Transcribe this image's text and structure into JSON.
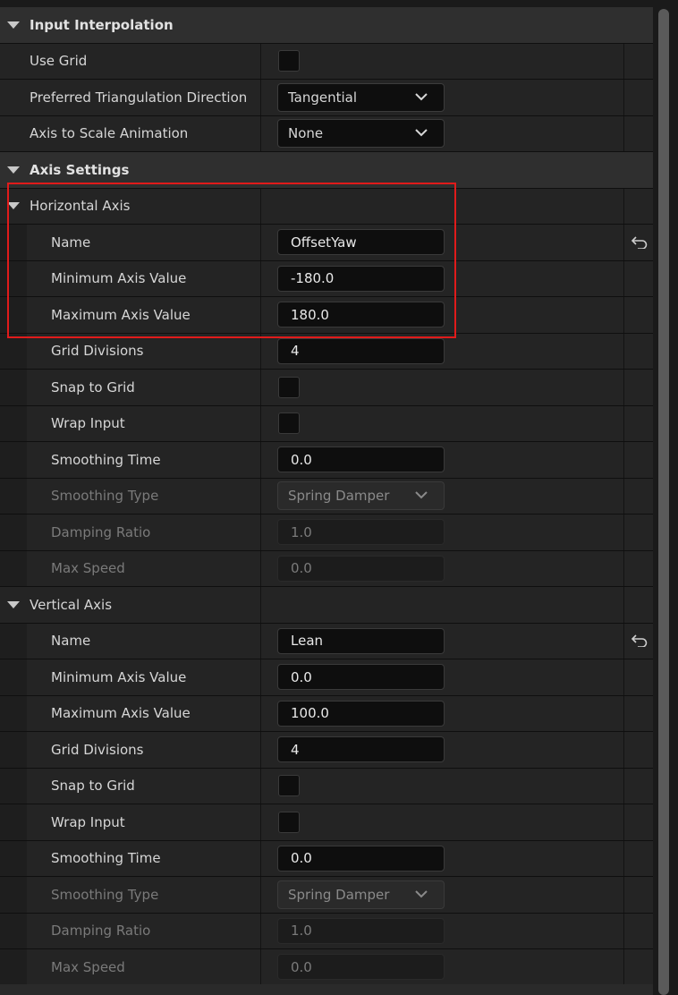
{
  "input_interpolation": {
    "header": "Input Interpolation",
    "use_grid_label": "Use Grid",
    "triangulation_label": "Preferred Triangulation Direction",
    "triangulation_value": "Tangential",
    "axis_scale_label": "Axis to Scale Animation",
    "axis_scale_value": "None"
  },
  "axis_settings": {
    "header": "Axis Settings"
  },
  "horizontal_axis": {
    "header": "Horizontal Axis",
    "name_label": "Name",
    "name_value": "OffsetYaw",
    "min_label": "Minimum Axis Value",
    "min_value": "-180.0",
    "max_label": "Maximum Axis Value",
    "max_value": "180.0",
    "grid_div_label": "Grid Divisions",
    "grid_div_value": "4",
    "snap_label": "Snap to Grid",
    "wrap_label": "Wrap Input",
    "smoothing_time_label": "Smoothing Time",
    "smoothing_time_value": "0.0",
    "smoothing_type_label": "Smoothing Type",
    "smoothing_type_value": "Spring Damper",
    "damping_label": "Damping Ratio",
    "damping_value": "1.0",
    "max_speed_label": "Max Speed",
    "max_speed_value": "0.0"
  },
  "vertical_axis": {
    "header": "Vertical Axis",
    "name_label": "Name",
    "name_value": "Lean",
    "min_label": "Minimum Axis Value",
    "min_value": "0.0",
    "max_label": "Maximum Axis Value",
    "max_value": "100.0",
    "grid_div_label": "Grid Divisions",
    "grid_div_value": "4",
    "snap_label": "Snap to Grid",
    "wrap_label": "Wrap Input",
    "smoothing_time_label": "Smoothing Time",
    "smoothing_time_value": "0.0",
    "smoothing_type_label": "Smoothing Type",
    "smoothing_type_value": "Spring Damper",
    "damping_label": "Damping Ratio",
    "damping_value": "1.0",
    "max_speed_label": "Max Speed",
    "max_speed_value": "0.0"
  },
  "icons": {
    "collapse": "triangle-down-icon",
    "dropdown": "chevron-down-icon",
    "reset": "reset-to-default-icon"
  },
  "colors": {
    "highlight": "#e01b1b",
    "panel_bg": "#242424",
    "section_bg": "#2f2f2f",
    "field_bg": "#0e0e0e"
  }
}
